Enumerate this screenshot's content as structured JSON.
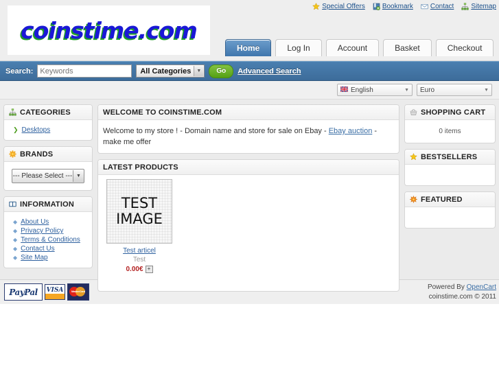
{
  "header": {
    "logo_text": "coinstime.com",
    "logo_color": "#1a18d6",
    "logo_shadow_color": "#1f9d28",
    "top_links": [
      {
        "label": "Special Offers",
        "icon": "star-icon"
      },
      {
        "label": "Bookmark",
        "icon": "bookmark-add-icon"
      },
      {
        "label": "Contact",
        "icon": "envelope-icon"
      },
      {
        "label": "Sitemap",
        "icon": "sitemap-icon"
      }
    ],
    "tabs": [
      {
        "label": "Home",
        "active": true
      },
      {
        "label": "Log In",
        "active": false
      },
      {
        "label": "Account",
        "active": false
      },
      {
        "label": "Basket",
        "active": false
      },
      {
        "label": "Checkout",
        "active": false
      }
    ]
  },
  "search": {
    "label": "Search:",
    "placeholder": "Keywords",
    "value": "",
    "category_selected": "All Categories",
    "go_label": "Go",
    "advanced_label": "Advanced Search"
  },
  "selectors": {
    "language": {
      "value": "English",
      "icon": "uk-flag-icon"
    },
    "currency": {
      "value": "Euro"
    }
  },
  "sidebar_left": {
    "categories": {
      "title": "CATEGORIES",
      "icon": "sitemap-icon",
      "items": [
        {
          "label": "Desktops"
        }
      ]
    },
    "brands": {
      "title": "BRANDS",
      "icon": "asterisk-icon",
      "select_value": "--- Please Select ---"
    },
    "information": {
      "title": "INFORMATION",
      "icon": "book-icon",
      "items": [
        {
          "label": "About Us"
        },
        {
          "label": "Privacy Policy"
        },
        {
          "label": "Terms & Conditions"
        },
        {
          "label": "Contact Us"
        },
        {
          "label": "Site Map"
        }
      ]
    }
  },
  "main": {
    "welcome": {
      "title": "WELCOME TO COINSTIME.COM",
      "text_before": "Welcome to my store ! - Domain name and store for sale on Ebay - ",
      "link_label": "Ebay auction",
      "text_after": " - make me offer"
    },
    "latest": {
      "title": "LATEST PRODUCTS",
      "products": [
        {
          "image_line1": "TEST",
          "image_line2": "IMAGE",
          "name": "Test articel",
          "description": "Test",
          "price": "0.00€",
          "price_color": "#b32121",
          "add_icon": "plus-box-icon"
        }
      ]
    }
  },
  "sidebar_right": {
    "cart": {
      "title": "SHOPPING CART",
      "icon": "basket-icon",
      "items_text": "0 items"
    },
    "bestsellers": {
      "title": "BESTSELLERS",
      "icon": "star-icon",
      "items": []
    },
    "featured": {
      "title": "FEATURED",
      "icon": "starburst-icon",
      "items": []
    }
  },
  "footer": {
    "payments": [
      {
        "label": "PayPal",
        "icon": "paypal-icon"
      },
      {
        "label": "VISA",
        "icon": "visa-icon"
      },
      {
        "label": "MasterCard",
        "icon": "mastercard-icon"
      }
    ],
    "powered_prefix": "Powered By ",
    "powered_link": "OpenCart",
    "copyright": "coinstime.com © 2011"
  }
}
